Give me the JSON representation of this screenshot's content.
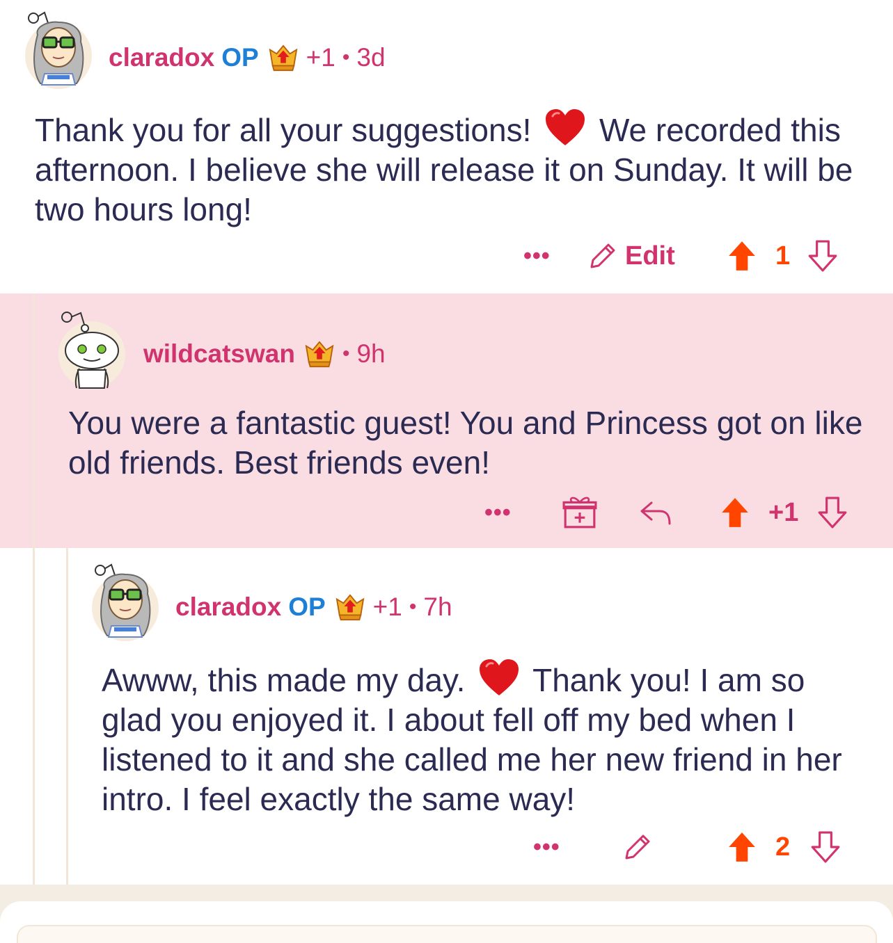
{
  "colors": {
    "username": "#d0336d",
    "op": "#1d7fd6",
    "upvote": "#ff4500",
    "highlight_bg": "#f9dde2",
    "text": "#2b2a52"
  },
  "comments": [
    {
      "username": "claradox",
      "op_label": "OP",
      "karma": "+1",
      "time": "3d",
      "text_before_heart": "Thank you for all your suggestions! ",
      "text_after_heart": " We recorded this afternoon. I believe she will release it on Sunday. It will be two hours long!",
      "actions": {
        "more": "•••",
        "edit": "Edit",
        "vote_count": "1"
      },
      "icons": [
        "avatar",
        "award-badge-icon",
        "heart-icon",
        "pencil-icon",
        "upvote-icon",
        "downvote-icon"
      ]
    },
    {
      "username": "wildcatswan",
      "time": "9h",
      "text": "You were a fantastic guest! You and Princess got on like old friends. Best friends even!",
      "actions": {
        "more": "•••",
        "vote_count": "+1"
      },
      "icons": [
        "avatar",
        "award-badge-icon",
        "gift-icon",
        "reply-icon",
        "upvote-icon",
        "downvote-icon"
      ]
    },
    {
      "username": "claradox",
      "op_label": "OP",
      "karma": "+1",
      "time": "7h",
      "text_before_heart": "Awww, this made my day. ",
      "text_after_heart": " Thank you! I am so glad you enjoyed it. I about fell off my bed when I listened to it and she called me her new friend in her intro. I feel exactly the same way!",
      "actions": {
        "more": "•••",
        "vote_count": "2"
      },
      "icons": [
        "avatar",
        "award-badge-icon",
        "heart-icon",
        "pencil-icon",
        "upvote-icon",
        "downvote-icon"
      ]
    }
  ],
  "separator": "•"
}
